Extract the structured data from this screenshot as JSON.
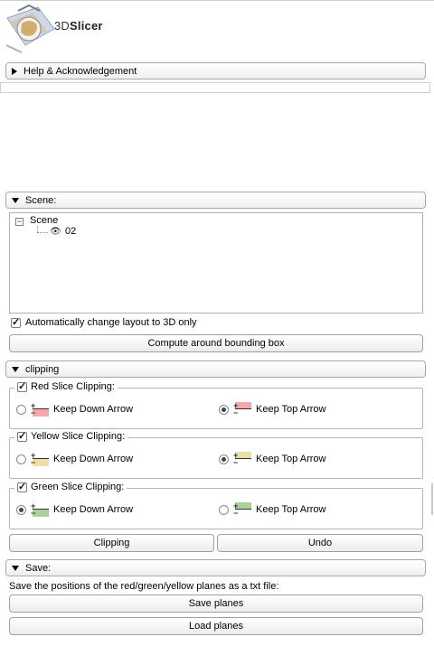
{
  "logo": {
    "text_prefix": "3D",
    "text_suffix": "Slicer"
  },
  "help_section": {
    "label": "Help & Acknowledgement"
  },
  "scene_section": {
    "label": "Scene:",
    "tree": {
      "root": "Scene",
      "child": "02"
    },
    "auto_layout_label": "Automatically change layout to 3D only",
    "compute_button": "Compute around bounding box"
  },
  "clipping_section": {
    "label": "clipping",
    "groups": [
      {
        "title": "Red Slice Clipping:",
        "down_label": "Keep Down Arrow",
        "top_label": "Keep Top Arrow",
        "selected": "top",
        "color": "#f4a9a9"
      },
      {
        "title": "Yellow Slice Clipping:",
        "down_label": "Keep Down Arrow",
        "top_label": "Keep Top Arrow",
        "selected": "top",
        "color": "#eadfa6"
      },
      {
        "title": "Green Slice Clipping:",
        "down_label": "Keep Down Arrow",
        "top_label": "Keep Top Arrow",
        "selected": "down",
        "color": "#a9d19c"
      }
    ],
    "clipping_button": "Clipping",
    "undo_button": "Undo"
  },
  "save_section": {
    "label": "Save:",
    "description": "Save the positions of the red/green/yellow planes as a txt file:",
    "save_button": "Save planes",
    "load_button": "Load planes"
  }
}
